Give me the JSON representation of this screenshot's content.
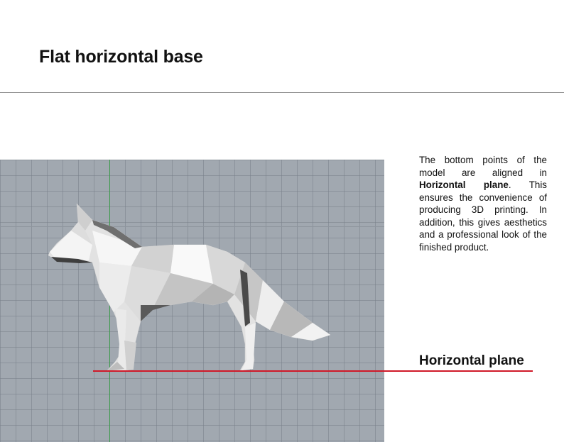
{
  "page": {
    "title": "Flat horizontal base"
  },
  "description": {
    "part1": "The bottom points of the model are aligned in ",
    "bold": "Horizontal plane",
    "part2": ". This ensures the convenience of producing 3D printing. In addition, this gives aesthetics and a professional look of the finished product."
  },
  "plane_label": "Horizontal plane",
  "viewport": {
    "background_color": "#a1a8b0",
    "axis_color": "#3a9a4a"
  },
  "colors": {
    "plane_line": "#d01828",
    "model": "#e4e4e4"
  },
  "model": {
    "icon": "low-poly-fox-icon"
  }
}
